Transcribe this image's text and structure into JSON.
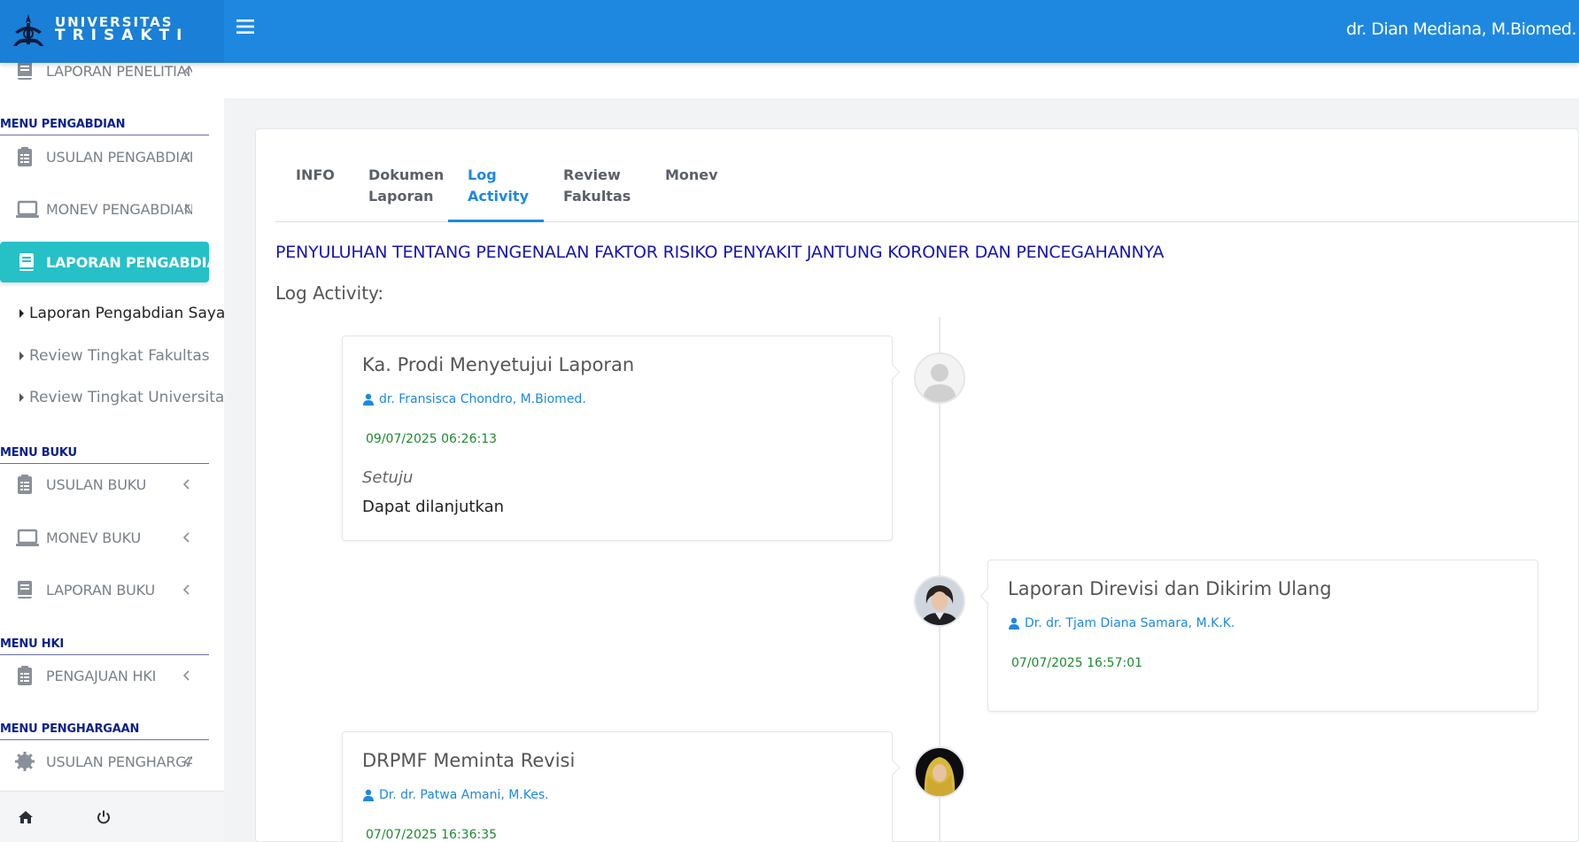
{
  "header": {
    "logo_line1": "UNIVERSITAS",
    "logo_line2": "TRISAKTI",
    "user_name": "dr. Dian Mediana, M.Biomed."
  },
  "sidebar": {
    "top_item": "LAPORAN PENELITIAN",
    "sections": [
      {
        "header": "MENU PENGABDIAN"
      },
      {
        "header": "MENU BUKU"
      },
      {
        "header": "MENU HKI"
      },
      {
        "header": "MENU PENGHARGAAN"
      }
    ],
    "pengabdian_items": [
      {
        "label": "USULAN PENGABDIAN",
        "icon": "clipboard-icon"
      },
      {
        "label": "MONEV PENGABDIAN",
        "icon": "laptop-icon"
      },
      {
        "label": "LAPORAN PENGABDIAN",
        "icon": "book-icon",
        "active": true
      }
    ],
    "laporan_subitems": [
      {
        "label": "Laporan Pengabdian Saya",
        "current": true
      },
      {
        "label": "Review Tingkat Fakultas"
      },
      {
        "label": "Review Tingkat Universitas"
      }
    ],
    "buku_items": [
      {
        "label": "USULAN BUKU",
        "icon": "clipboard-icon"
      },
      {
        "label": "MONEV BUKU",
        "icon": "laptop-icon"
      },
      {
        "label": "LAPORAN BUKU",
        "icon": "book-icon"
      }
    ],
    "hki_items": [
      {
        "label": "PENGAJUAN HKI",
        "icon": "clipboard-icon"
      }
    ],
    "penghargaan_items": [
      {
        "label": "USULAN PENGHARGAAN",
        "icon": "gear-icon"
      }
    ]
  },
  "tabs": [
    {
      "line1": "INFO",
      "line2": ""
    },
    {
      "line1": "Dokumen",
      "line2": "Laporan"
    },
    {
      "line1": "Log",
      "line2": "Activity",
      "active": true
    },
    {
      "line1": "Review",
      "line2": "Fakultas"
    },
    {
      "line1": "Monev",
      "line2": ""
    }
  ],
  "project_title": "PENYULUHAN TENTANG PENGENALAN FAKTOR RISIKO PENYAKIT JANTUNG KORONER DAN PENCEGAHANNYA",
  "log_label": "Log Activity:",
  "timeline": [
    {
      "title": "Ka. Prodi Menyetujui Laporan",
      "user": "dr. Fransisca Chondro, M.Biomed.",
      "datetime": "09/07/2025 06:26:13",
      "status": "Setuju",
      "note": "Dapat dilanjutkan",
      "side": "left"
    },
    {
      "title": "Laporan Direvisi dan Dikirim Ulang",
      "user": "Dr. dr. Tjam Diana Samara, M.K.K.",
      "datetime": "07/07/2025 16:57:01",
      "side": "right"
    },
    {
      "title": "DRPMF Meminta Revisi",
      "user": "Dr. dr. Patwa Amani, M.Kes.",
      "datetime": "07/07/2025 16:36:35",
      "side": "left"
    }
  ],
  "colors": {
    "topbar": "#1e88e0",
    "active_menu": "#26c0c7",
    "section_header": "#0a1f8f",
    "project_title": "#1515b8",
    "timestamp": "#1e8a2e"
  }
}
